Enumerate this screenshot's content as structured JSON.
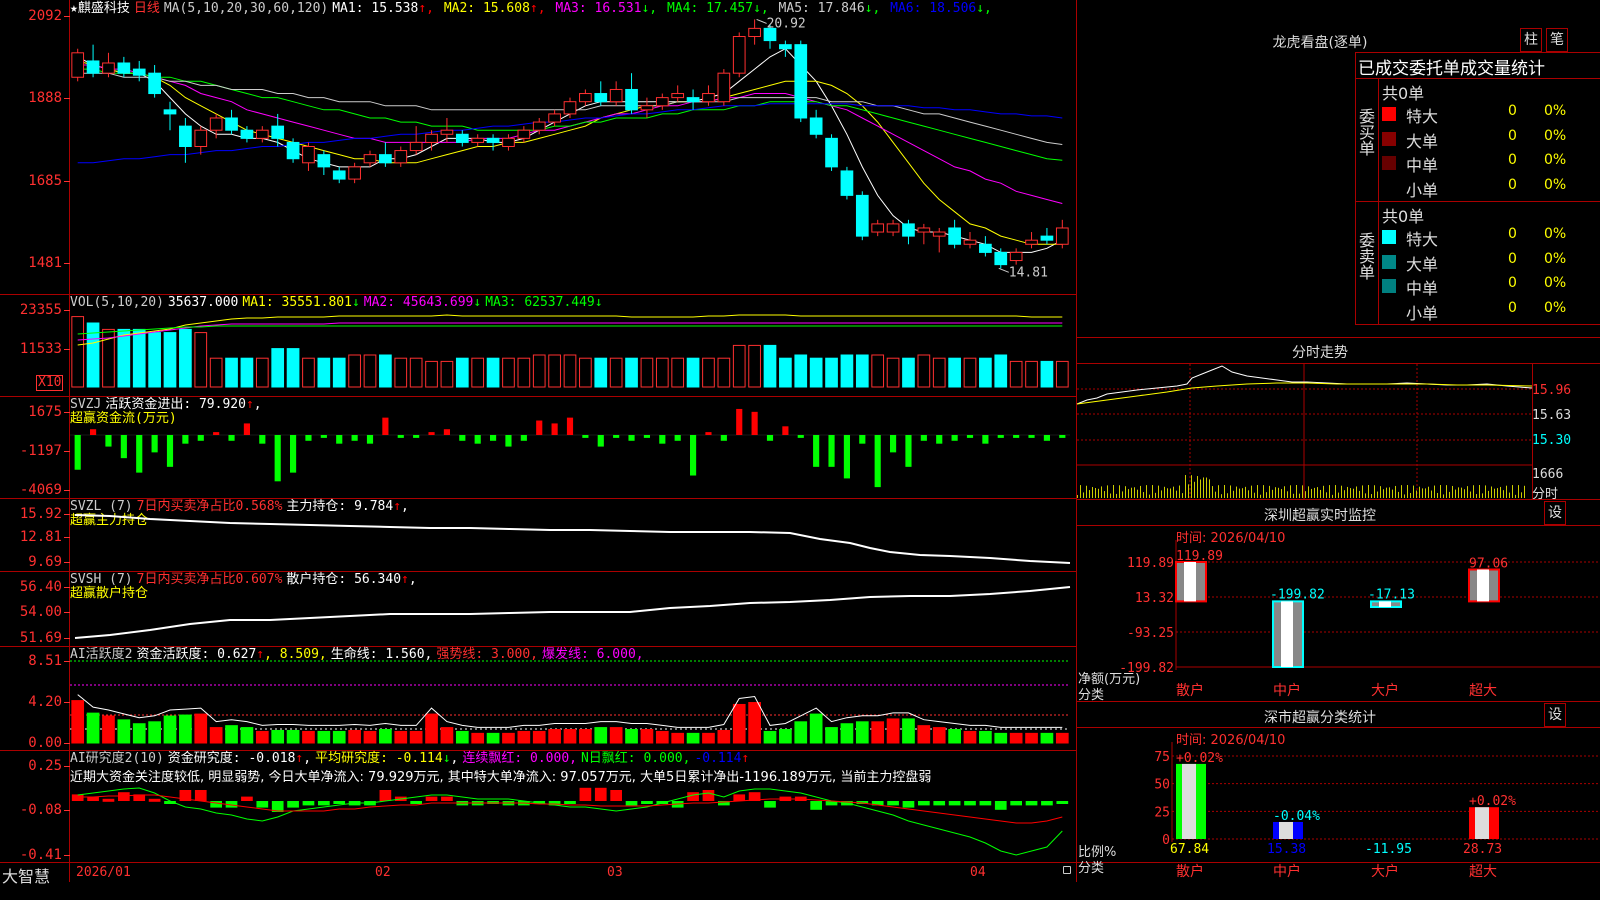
{
  "main_header": {
    "star": "★",
    "name": "麒盛科技",
    "period": "日线",
    "ma_def": "MA(5,10,20,30,60,120)",
    "ma": [
      {
        "label": "MA1: 15.538",
        "arrow": "↑",
        "color": "#ffffff"
      },
      {
        "label": "MA2: 15.608",
        "arrow": "↑",
        "color": "#ffff00"
      },
      {
        "label": "MA3: 16.531",
        "arrow": "↓",
        "color": "#ff00ff"
      },
      {
        "label": "MA4: 17.457",
        "arrow": "↓",
        "color": "#00ff00"
      },
      {
        "label": "MA5: 17.846",
        "arrow": "↓",
        "color": "#cccccc"
      },
      {
        "label": "MA6: 18.506",
        "arrow": "↓",
        "color": "#0000ff"
      }
    ],
    "high_label": "20.92",
    "low_label": "14.81"
  },
  "price_axis": [
    "2092",
    "1888",
    "1685",
    "1481"
  ],
  "vol_header": {
    "def": "VOL(5,10,20)",
    "value": "35637.000",
    "ma1": "MA1: 35551.801",
    "ma1_arrow": "↓",
    "ma2": "MA2: 45643.699",
    "ma2_arrow": "↓",
    "ma3": "MA3: 62537.449",
    "ma3_arrow": "↓"
  },
  "vol_axis": [
    "23355",
    "11533"
  ],
  "vol_unit": "X10",
  "svzj": {
    "def": "SVZJ",
    "text": "活跃资金进出: 79.920",
    "arrow": "↑",
    "trail": ",",
    "sub": "超赢资金流(万元)",
    "axis": [
      "1675",
      "-1197",
      "-4069"
    ]
  },
  "svzl": {
    "def": "SVZL (7)",
    "text1": "7日内买卖净占比0.568%",
    "text2": "主力持仓: 9.784",
    "arrow": "↑",
    "trail": ",",
    "sub": "超赢主力持仓",
    "axis": [
      "15.92",
      "12.81",
      "9.69"
    ]
  },
  "svsh": {
    "def": "SVSH (7)",
    "text1": "7日内买卖净占比0.607%",
    "text2": "散户持仓: 56.340",
    "arrow": "↑",
    "trail": ",",
    "sub": "超赢散户持仓",
    "axis": [
      "56.40",
      "54.00",
      "51.69"
    ]
  },
  "ai_active": {
    "def": "AI活跃度2",
    "t1": "资金活跃度: 0.627",
    "a1": "↑",
    "t2": ", 8.509,",
    "t3": "生命线: 1.560,",
    "t4": "强势线: 3.000,",
    "t5": "爆发线: 6.000,",
    "axis": [
      "8.51",
      "4.20",
      "0.00"
    ]
  },
  "ai_research": {
    "def": "AI研究度2(10)",
    "t1": "资金研究度: -0.018",
    "a1": "↑",
    "t2": ",",
    "t3": "平均研究度: -0.114",
    "a3": "↓",
    "t4": ",",
    "t5": "连续飘红: 0.000,",
    "t6": "N日飘红: 0.000,",
    "t7": "-0.114",
    "a7": "↑",
    "summary": "近期大资金关注度较低, 明显弱势, 今日大单净流入: 79.929万元, 其中特大单净流入: 97.057万元, 大单5日累计净出-1196.189万元, 当前主力控盘弱",
    "axis": [
      "0.25",
      "-0.08",
      "-0.41"
    ]
  },
  "bottom_bar": {
    "brand": "大智慧",
    "dates": [
      "2026/01",
      "02",
      "03",
      "04"
    ]
  },
  "longhu": {
    "title": "龙虎看盘(逐单)",
    "btn_zhu": "柱",
    "btn_bi": "笔",
    "subtitle": "已成交委托单成交量统计",
    "buy_label": "委买单",
    "sell_label": "委卖单",
    "buy_total": "共0单",
    "sell_total": "共0单",
    "rows": [
      {
        "name": "特大",
        "count": "0",
        "pct": "0%"
      },
      {
        "name": "大单",
        "count": "0",
        "pct": "0%"
      },
      {
        "name": "中单",
        "count": "0",
        "pct": "0%"
      },
      {
        "name": "小单",
        "count": "0",
        "pct": "0%"
      }
    ],
    "buy_colors": [
      "#ff0000",
      "#880000",
      "#660000",
      "#000000"
    ],
    "sell_colors": [
      "#00ffff",
      "#008888",
      "#008080",
      "#000000"
    ]
  },
  "minute": {
    "title": "分时走势",
    "axis": [
      "15.96",
      "15.63",
      "15.30",
      "1666"
    ],
    "vol_label": "分时"
  },
  "sz_monitor": {
    "title": "深圳超赢实时监控",
    "btn": "设",
    "time": "时间: 2026/04/10",
    "axis": [
      "119.89",
      "13.32",
      "-93.25",
      "-199.82"
    ],
    "ylabel": "净额(万元)",
    "xlabel": "分类",
    "categories": [
      "散户",
      "中户",
      "大户",
      "超大"
    ],
    "values": [
      119.89,
      -199.82,
      -17.13,
      97.06
    ],
    "value_labels": [
      "119.89",
      "-199.82",
      "-17.13",
      "97.06"
    ]
  },
  "sz_class": {
    "title": "深市超赢分类统计",
    "btn": "设",
    "time": "时间: 2026/04/10",
    "axis": [
      "75",
      "50",
      "25",
      "0"
    ],
    "ylabel": "比例%",
    "xlabel": "分类",
    "categories": [
      "散户",
      "中户",
      "大户",
      "超大"
    ],
    "top_labels": [
      "+0.02%",
      "-0.04%",
      "",
      "+0.02%"
    ],
    "values": [
      67.84,
      15.38,
      -11.95,
      28.73
    ],
    "value_labels": [
      "67.84",
      "15.38",
      "-11.95",
      "28.73"
    ]
  },
  "chart_data": {
    "type": "candlestick",
    "title": "麒盛科技 日线",
    "y_range": [
      14.81,
      20.92
    ],
    "candles": [
      {
        "o": 19.5,
        "c": 20.1,
        "h": 20.2,
        "l": 19.4
      },
      {
        "o": 19.9,
        "c": 19.6,
        "h": 20.3,
        "l": 19.5
      },
      {
        "o": 19.6,
        "c": 19.85,
        "h": 20.1,
        "l": 19.5
      },
      {
        "o": 19.85,
        "c": 19.6,
        "h": 20.0,
        "l": 19.5
      },
      {
        "o": 19.7,
        "c": 19.55,
        "h": 19.9,
        "l": 19.4
      },
      {
        "o": 19.6,
        "c": 19.1,
        "h": 19.8,
        "l": 19.0
      },
      {
        "o": 18.7,
        "c": 18.6,
        "h": 18.9,
        "l": 18.2
      },
      {
        "o": 18.3,
        "c": 17.8,
        "h": 18.5,
        "l": 17.4
      },
      {
        "o": 17.8,
        "c": 18.2,
        "h": 18.3,
        "l": 17.6
      },
      {
        "o": 18.2,
        "c": 18.5,
        "h": 18.6,
        "l": 18.0
      },
      {
        "o": 18.5,
        "c": 18.2,
        "h": 18.7,
        "l": 18.1
      },
      {
        "o": 18.2,
        "c": 18.0,
        "h": 18.3,
        "l": 17.9
      },
      {
        "o": 18.0,
        "c": 18.2,
        "h": 18.3,
        "l": 17.9
      },
      {
        "o": 18.3,
        "c": 18.0,
        "h": 18.6,
        "l": 17.8
      },
      {
        "o": 17.9,
        "c": 17.5,
        "h": 18.0,
        "l": 17.4
      },
      {
        "o": 17.4,
        "c": 17.8,
        "h": 17.9,
        "l": 17.2
      },
      {
        "o": 17.6,
        "c": 17.3,
        "h": 17.7,
        "l": 17.1
      },
      {
        "o": 17.2,
        "c": 17.0,
        "h": 17.3,
        "l": 16.9
      },
      {
        "o": 17.0,
        "c": 17.3,
        "h": 17.4,
        "l": 16.9
      },
      {
        "o": 17.4,
        "c": 17.6,
        "h": 17.7,
        "l": 17.3
      },
      {
        "o": 17.6,
        "c": 17.4,
        "h": 17.9,
        "l": 17.3
      },
      {
        "o": 17.4,
        "c": 17.7,
        "h": 17.8,
        "l": 17.3
      },
      {
        "o": 17.7,
        "c": 17.9,
        "h": 18.3,
        "l": 17.6
      },
      {
        "o": 17.9,
        "c": 18.1,
        "h": 18.2,
        "l": 17.7
      },
      {
        "o": 18.1,
        "c": 18.2,
        "h": 18.5,
        "l": 17.9
      },
      {
        "o": 18.1,
        "c": 17.9,
        "h": 18.2,
        "l": 17.8
      },
      {
        "o": 17.9,
        "c": 18.0,
        "h": 18.1,
        "l": 17.8
      },
      {
        "o": 18.0,
        "c": 17.9,
        "h": 18.1,
        "l": 17.7
      },
      {
        "o": 17.8,
        "c": 18.0,
        "h": 18.1,
        "l": 17.7
      },
      {
        "o": 18.0,
        "c": 18.2,
        "h": 18.3,
        "l": 17.9
      },
      {
        "o": 18.2,
        "c": 18.4,
        "h": 18.5,
        "l": 18.1
      },
      {
        "o": 18.4,
        "c": 18.6,
        "h": 18.7,
        "l": 18.3
      },
      {
        "o": 18.6,
        "c": 18.9,
        "h": 19.0,
        "l": 18.5
      },
      {
        "o": 18.9,
        "c": 19.1,
        "h": 19.2,
        "l": 18.8
      },
      {
        "o": 19.1,
        "c": 18.9,
        "h": 19.4,
        "l": 18.8
      },
      {
        "o": 18.9,
        "c": 19.2,
        "h": 19.4,
        "l": 18.8
      },
      {
        "o": 19.2,
        "c": 18.7,
        "h": 19.6,
        "l": 18.6
      },
      {
        "o": 18.7,
        "c": 18.8,
        "h": 19.0,
        "l": 18.5
      },
      {
        "o": 18.8,
        "c": 19.0,
        "h": 19.1,
        "l": 18.7
      },
      {
        "o": 19.0,
        "c": 19.1,
        "h": 19.3,
        "l": 18.9
      },
      {
        "o": 19.0,
        "c": 18.9,
        "h": 19.2,
        "l": 18.7
      },
      {
        "o": 18.9,
        "c": 19.1,
        "h": 19.3,
        "l": 18.8
      },
      {
        "o": 18.9,
        "c": 19.6,
        "h": 19.7,
        "l": 18.8
      },
      {
        "o": 19.6,
        "c": 20.5,
        "h": 20.6,
        "l": 19.5
      },
      {
        "o": 20.5,
        "c": 20.7,
        "h": 20.92,
        "l": 20.3
      },
      {
        "o": 20.7,
        "c": 20.4,
        "h": 20.8,
        "l": 20.2
      },
      {
        "o": 20.3,
        "c": 20.2,
        "h": 20.4,
        "l": 20.0
      },
      {
        "o": 20.3,
        "c": 18.5,
        "h": 20.4,
        "l": 18.4
      },
      {
        "o": 18.5,
        "c": 18.1,
        "h": 18.7,
        "l": 18.0
      },
      {
        "o": 18.0,
        "c": 17.3,
        "h": 18.1,
        "l": 17.2
      },
      {
        "o": 17.2,
        "c": 16.6,
        "h": 17.3,
        "l": 16.5
      },
      {
        "o": 16.6,
        "c": 15.6,
        "h": 16.7,
        "l": 15.5
      },
      {
        "o": 15.7,
        "c": 15.9,
        "h": 16.0,
        "l": 15.6
      },
      {
        "o": 15.7,
        "c": 15.9,
        "h": 16.0,
        "l": 15.6
      },
      {
        "o": 15.9,
        "c": 15.6,
        "h": 16.0,
        "l": 15.4
      },
      {
        "o": 15.7,
        "c": 15.8,
        "h": 15.9,
        "l": 15.4
      },
      {
        "o": 15.6,
        "c": 15.7,
        "h": 15.8,
        "l": 15.2
      },
      {
        "o": 15.8,
        "c": 15.4,
        "h": 16.0,
        "l": 15.3
      },
      {
        "o": 15.4,
        "c": 15.5,
        "h": 15.7,
        "l": 15.3
      },
      {
        "o": 15.4,
        "c": 15.2,
        "h": 15.6,
        "l": 15.1
      },
      {
        "o": 15.2,
        "c": 14.9,
        "h": 15.3,
        "l": 14.81
      },
      {
        "o": 15.0,
        "c": 15.2,
        "h": 15.3,
        "l": 14.9
      },
      {
        "o": 15.4,
        "c": 15.5,
        "h": 15.7,
        "l": 15.3
      },
      {
        "o": 15.6,
        "c": 15.5,
        "h": 15.8,
        "l": 15.4
      },
      {
        "o": 15.4,
        "c": 15.8,
        "h": 16.0,
        "l": 15.3
      }
    ],
    "ma": [
      {
        "name": "MA1",
        "color": "#ffffff",
        "points": [
          20.0,
          19.8,
          19.7,
          19.6,
          19.6,
          19.4,
          19.0,
          18.6,
          18.3,
          18.1,
          18.1,
          18.0,
          18.0,
          17.9,
          17.7,
          17.5,
          17.4,
          17.3,
          17.3,
          17.3,
          17.5,
          17.5,
          17.6,
          17.8,
          18.0,
          18.0,
          18.0,
          17.9,
          17.9,
          18.0,
          18.2,
          18.4,
          18.6,
          18.8,
          18.9,
          18.9,
          18.9,
          18.9,
          18.9,
          18.9,
          18.9,
          19.0,
          19.1,
          19.4,
          19.7,
          20.0,
          20.2,
          19.8,
          19.4,
          18.8,
          18.1,
          17.3,
          16.6,
          16.1,
          15.8,
          15.7,
          15.7,
          15.6,
          15.5,
          15.4,
          15.2,
          15.2,
          15.2,
          15.3,
          15.5
        ]
      },
      {
        "name": "MA2",
        "color": "#ffff00",
        "points": [
          19.9,
          19.8,
          19.7,
          19.6,
          19.6,
          19.5,
          19.3,
          19.0,
          18.8,
          18.6,
          18.4,
          18.2,
          18.1,
          18.0,
          17.9,
          17.8,
          17.7,
          17.6,
          17.5,
          17.5,
          17.4,
          17.4,
          17.4,
          17.5,
          17.6,
          17.7,
          17.8,
          17.8,
          17.9,
          17.9,
          18.0,
          18.1,
          18.2,
          18.3,
          18.5,
          18.6,
          18.7,
          18.8,
          18.8,
          18.9,
          18.9,
          18.9,
          19.0,
          19.1,
          19.2,
          19.3,
          19.4,
          19.4,
          19.4,
          19.3,
          19.1,
          18.8,
          18.4,
          17.9,
          17.4,
          16.9,
          16.5,
          16.2,
          15.9,
          15.8,
          15.6,
          15.5,
          15.4,
          15.4,
          15.4
        ]
      },
      {
        "name": "MA3",
        "color": "#ff00ff",
        "points": [
          19.8,
          19.8,
          19.7,
          19.7,
          19.6,
          19.5,
          19.4,
          19.3,
          19.1,
          19.0,
          18.9,
          18.7,
          18.6,
          18.5,
          18.4,
          18.3,
          18.2,
          18.1,
          18.0,
          18.0,
          17.9,
          17.9,
          17.9,
          17.9,
          17.9,
          17.9,
          18.0,
          18.0,
          18.0,
          18.1,
          18.2,
          18.2,
          18.3,
          18.4,
          18.5,
          18.6,
          18.6,
          18.7,
          18.8,
          18.8,
          18.9,
          18.9,
          19.0,
          19.0,
          19.1,
          19.1,
          19.1,
          19.0,
          18.9,
          18.8,
          18.7,
          18.5,
          18.3,
          18.1,
          17.9,
          17.7,
          17.5,
          17.3,
          17.2,
          17.0,
          16.9,
          16.7,
          16.6,
          16.5,
          16.4
        ]
      },
      {
        "name": "MA4",
        "color": "#00ff00",
        "points": [
          19.7,
          19.7,
          19.6,
          19.6,
          19.6,
          19.5,
          19.5,
          19.4,
          19.4,
          19.3,
          19.2,
          19.1,
          19.0,
          19.0,
          18.9,
          18.8,
          18.7,
          18.7,
          18.6,
          18.5,
          18.5,
          18.4,
          18.4,
          18.3,
          18.3,
          18.3,
          18.2,
          18.2,
          18.2,
          18.2,
          18.2,
          18.3,
          18.3,
          18.4,
          18.4,
          18.5,
          18.5,
          18.5,
          18.6,
          18.6,
          18.7,
          18.7,
          18.7,
          18.8,
          18.8,
          18.9,
          18.9,
          18.9,
          18.9,
          18.8,
          18.8,
          18.7,
          18.6,
          18.5,
          18.4,
          18.3,
          18.2,
          18.1,
          18.0,
          17.9,
          17.8,
          17.7,
          17.6,
          17.5,
          17.46
        ]
      },
      {
        "name": "MA5",
        "color": "#cccccc",
        "points": [
          19.6,
          19.6,
          19.6,
          19.5,
          19.5,
          19.5,
          19.4,
          19.4,
          19.3,
          19.3,
          19.2,
          19.2,
          19.2,
          19.1,
          19.1,
          19.0,
          19.0,
          18.9,
          18.9,
          18.9,
          18.8,
          18.8,
          18.8,
          18.7,
          18.7,
          18.7,
          18.7,
          18.7,
          18.7,
          18.7,
          18.7,
          18.7,
          18.7,
          18.7,
          18.8,
          18.8,
          18.8,
          18.8,
          18.8,
          18.9,
          18.9,
          18.9,
          18.9,
          19.0,
          19.0,
          19.0,
          19.0,
          19.0,
          19.0,
          18.9,
          18.9,
          18.9,
          18.8,
          18.8,
          18.7,
          18.6,
          18.6,
          18.5,
          18.4,
          18.3,
          18.2,
          18.1,
          18.0,
          17.9,
          17.85
        ]
      },
      {
        "name": "MA6",
        "color": "#0000ff",
        "points": [
          17.4,
          17.4,
          17.45,
          17.5,
          17.5,
          17.55,
          17.6,
          17.6,
          17.65,
          17.7,
          17.7,
          17.75,
          17.8,
          17.8,
          17.85,
          17.9,
          17.9,
          17.95,
          18.0,
          18.0,
          18.05,
          18.1,
          18.1,
          18.15,
          18.2,
          18.2,
          18.25,
          18.3,
          18.3,
          18.35,
          18.4,
          18.4,
          18.45,
          18.5,
          18.5,
          18.55,
          18.6,
          18.6,
          18.65,
          18.7,
          18.7,
          18.75,
          18.8,
          18.8,
          18.8,
          18.85,
          18.85,
          18.85,
          18.85,
          18.85,
          18.85,
          18.8,
          18.8,
          18.8,
          18.8,
          18.75,
          18.75,
          18.7,
          18.7,
          18.65,
          18.6,
          18.6,
          18.55,
          18.55,
          18.5
        ]
      }
    ],
    "volume": [
      22,
      20,
      18,
      18,
      18,
      17,
      17,
      18,
      17,
      9,
      9,
      9,
      9,
      12,
      12,
      9,
      9,
      9,
      10,
      10,
      10,
      9,
      9,
      8,
      8,
      9,
      9,
      9,
      9,
      9,
      10,
      10,
      10,
      9,
      9,
      9,
      9,
      9,
      9,
      9,
      9,
      9,
      9,
      13,
      13,
      13,
      9,
      10,
      9,
      9,
      10,
      10,
      10,
      9,
      9,
      10,
      9,
      9,
      9,
      9,
      10,
      8,
      8,
      8,
      8
    ],
    "fund_flow": [
      -1200,
      200,
      -400,
      -800,
      -1300,
      -600,
      -1100,
      -300,
      -200,
      100,
      -200,
      400,
      -300,
      -1600,
      -1300,
      -200,
      -100,
      -300,
      -200,
      -300,
      600,
      -100,
      -100,
      100,
      200,
      -200,
      -300,
      -200,
      -400,
      -200,
      500,
      400,
      600,
      -100,
      -400,
      -100,
      -200,
      -100,
      -300,
      -200,
      -1400,
      100,
      -200,
      900,
      800,
      -200,
      300,
      -100,
      -1100,
      -1100,
      -1500,
      -300,
      -1800,
      -600,
      -1100,
      -200,
      -300,
      -200,
      -100,
      -300,
      -100,
      -100,
      -100,
      -200,
      -100
    ]
  }
}
